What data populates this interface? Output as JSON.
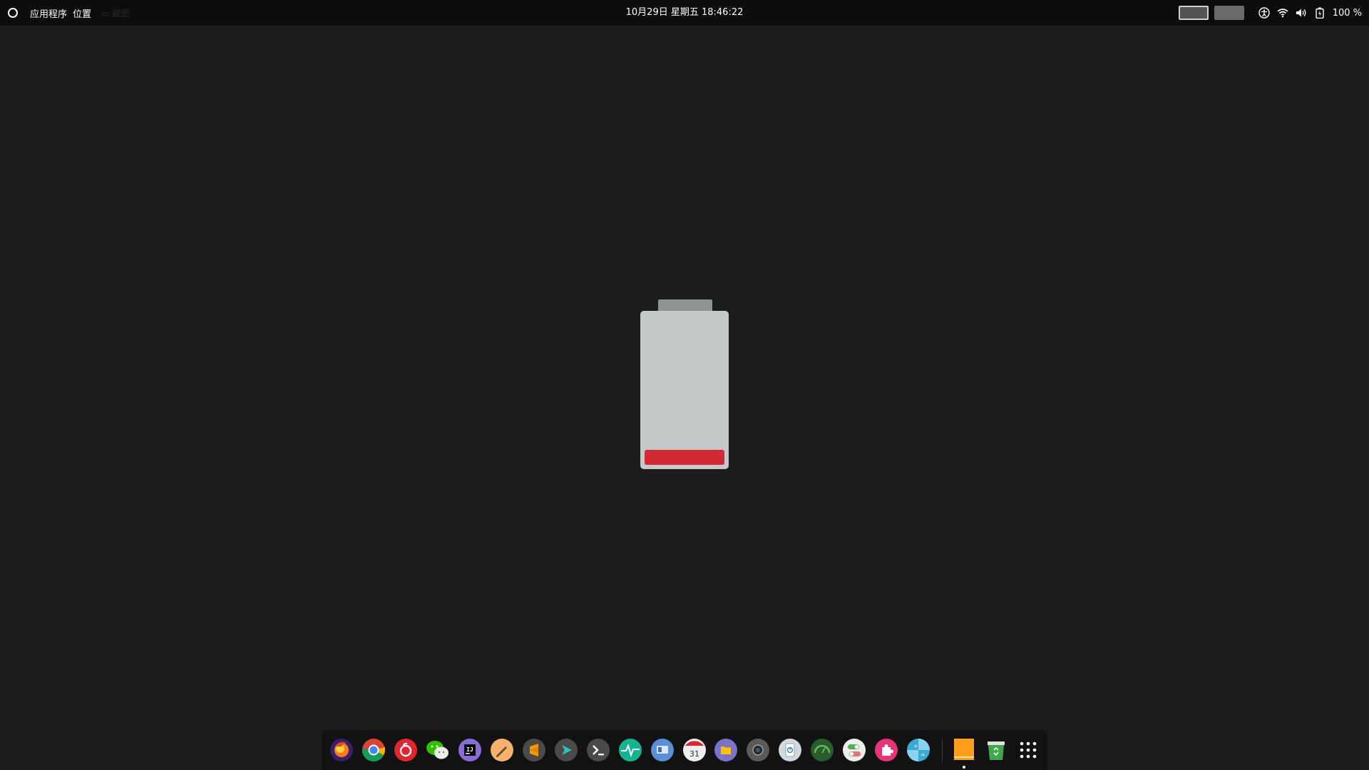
{
  "topbar": {
    "menu_applications": "应用程序",
    "menu_places": "位置",
    "dim_text": "▭ 截图",
    "datetime": "10月29日 星期五  18:46:22",
    "battery_percent": "100 %"
  },
  "battery_indicator": {
    "charge_level": 0.1,
    "fill_color": "#d32836",
    "body_color": "#c3c9c9"
  },
  "dock": {
    "apps": [
      {
        "name": "firefox",
        "icon": "firefox-icon"
      },
      {
        "name": "chrome",
        "icon": "chrome-icon"
      },
      {
        "name": "netease-music",
        "icon": "netease-music-icon"
      },
      {
        "name": "wechat",
        "icon": "wechat-icon"
      },
      {
        "name": "intellij-idea",
        "icon": "intellij-icon",
        "label": "IJ"
      },
      {
        "name": "pencil",
        "icon": "pencil-icon"
      },
      {
        "name": "sublime-text",
        "icon": "sublime-icon"
      },
      {
        "name": "remote-terminal",
        "icon": "arrow-icon"
      },
      {
        "name": "terminal",
        "icon": "terminal-icon"
      },
      {
        "name": "system-monitor",
        "icon": "pulse-icon"
      },
      {
        "name": "remote-desktop",
        "icon": "remote-desktop-icon"
      },
      {
        "name": "calendar",
        "icon": "calendar-icon",
        "label": "31"
      },
      {
        "name": "files",
        "icon": "folder-icon"
      },
      {
        "name": "camera",
        "icon": "camera-icon"
      },
      {
        "name": "disk-usage",
        "icon": "disk-icon"
      },
      {
        "name": "system-monitor-2",
        "icon": "gauge-icon"
      },
      {
        "name": "tweaks",
        "icon": "toggle-icon"
      },
      {
        "name": "extensions",
        "icon": "puzzle-icon"
      },
      {
        "name": "calculator",
        "icon": "calculator-icon"
      },
      {
        "name": "text-editor",
        "icon": "notepad-icon"
      },
      {
        "name": "trash",
        "icon": "trash-icon"
      },
      {
        "name": "show-applications",
        "icon": "grid-icon"
      }
    ]
  }
}
